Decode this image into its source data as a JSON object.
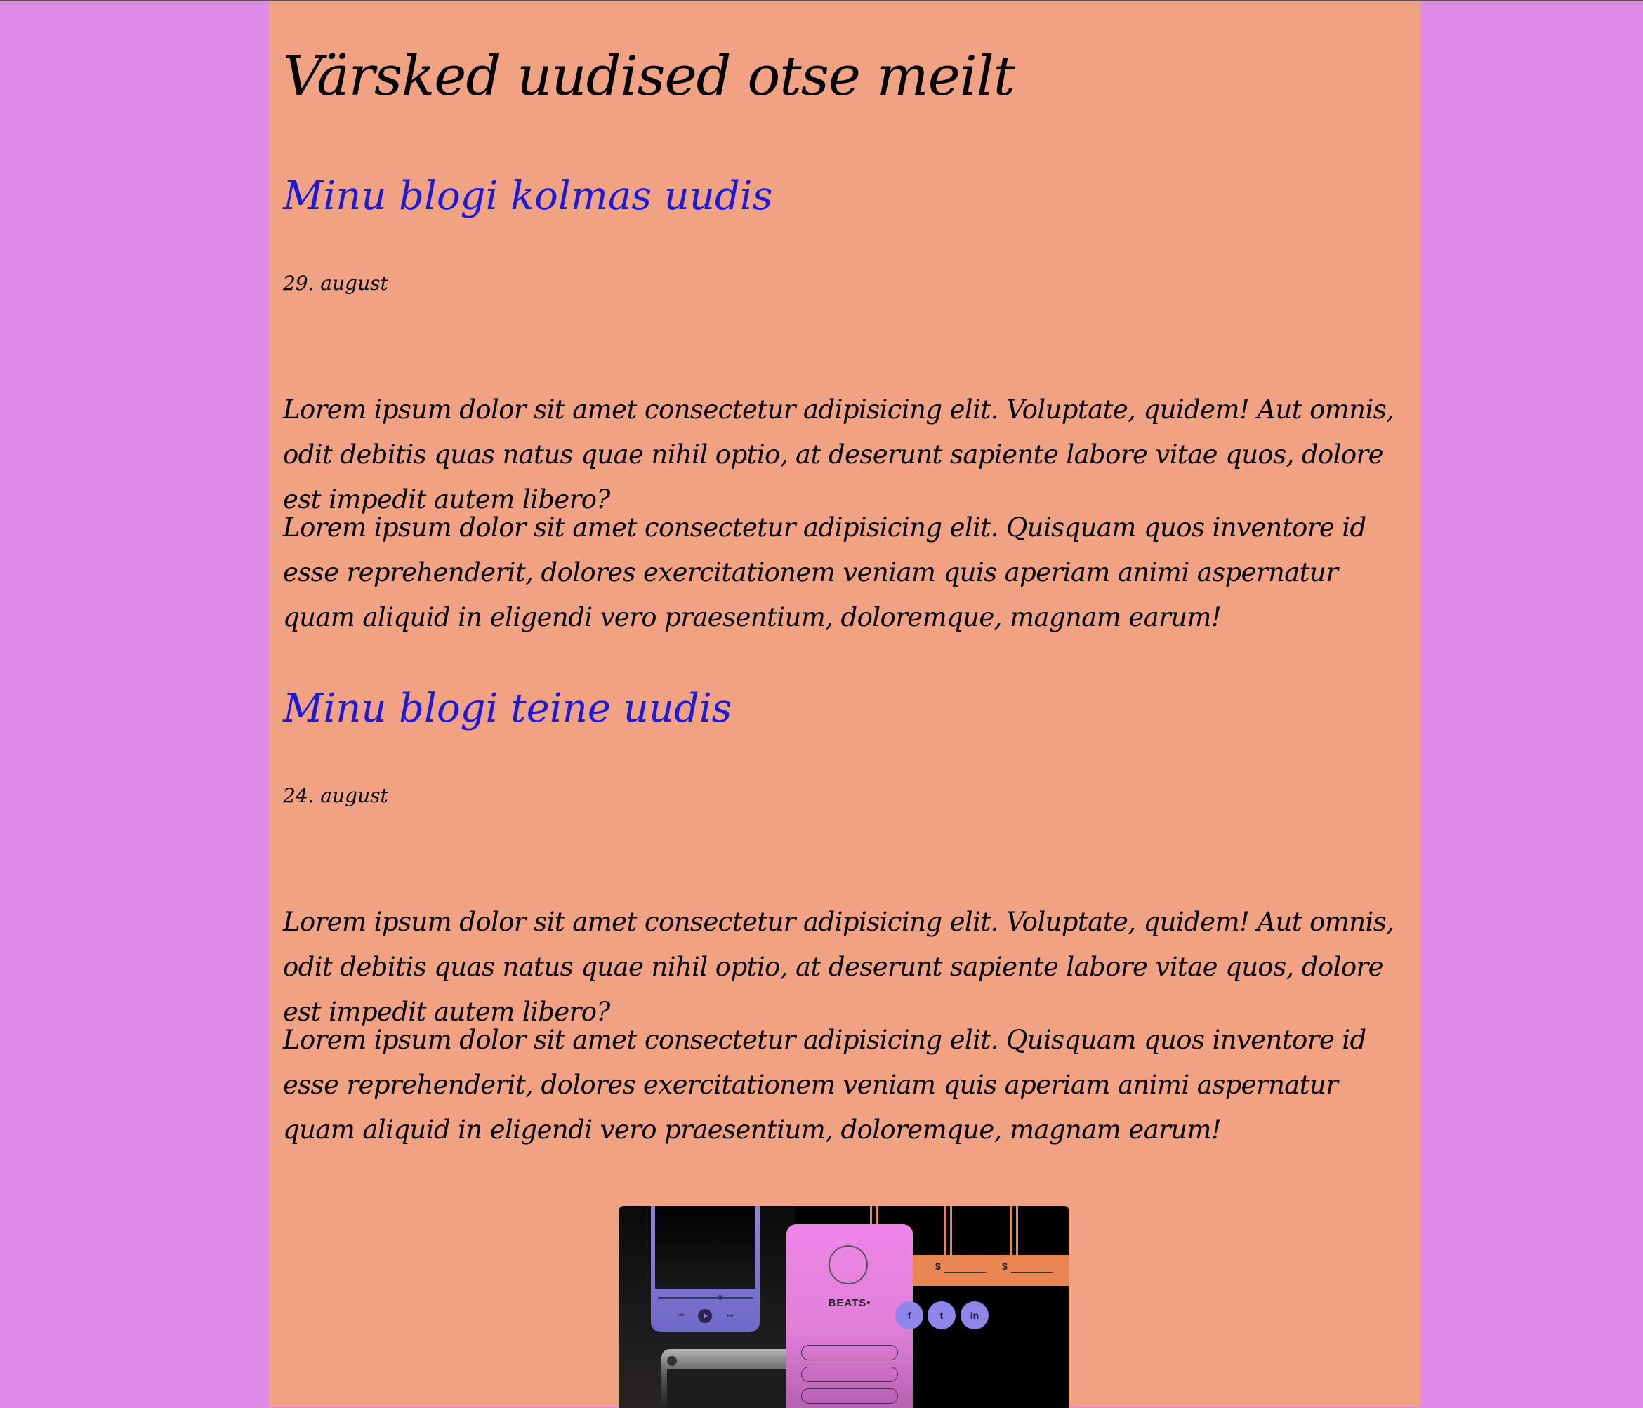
{
  "page": {
    "title": "Värsked uudised otse meilt"
  },
  "posts": [
    {
      "title": "Minu blogi kolmas uudis",
      "date": "29. august",
      "paragraphs": [
        "Lorem ipsum dolor sit amet consectetur adipisicing elit. Voluptate, quidem! Aut omnis, odit debitis quas natus quae nihil optio, at deserunt sapiente labore vitae quos, dolore est impedit autem libero?",
        "Lorem ipsum dolor sit amet consectetur adipisicing elit. Quisquam quos inventore id esse reprehenderit, dolores exercitationem veniam quis aperiam animi aspernatur quam aliquid in eligendi vero praesentium, doloremque, magnam earum!"
      ]
    },
    {
      "title": "Minu blogi teine uudis",
      "date": "24. august",
      "paragraphs": [
        "Lorem ipsum dolor sit amet consectetur adipisicing elit. Voluptate, quidem! Aut omnis, odit debitis quas natus quae nihil optio, at deserunt sapiente labore vitae quos, dolore est impedit autem libero?",
        "Lorem ipsum dolor sit amet consectetur adipisicing elit. Quisquam quos inventore id esse reprehenderit, dolores exercitationem veniam quis aperiam animi aspernatur quam aliquid in eligendi vero praesentium, doloremque, magnam earum!"
      ]
    }
  ],
  "image": {
    "brand_text": "BEATS•",
    "price_symbol": "$",
    "social_icons": [
      "facebook-icon",
      "twitter-icon",
      "linkedin-icon"
    ],
    "social_glyphs": [
      "f",
      "t",
      "in"
    ]
  },
  "colors": {
    "background": "#e08ae8",
    "page": "#f0a283",
    "link": "#1a1adf",
    "text": "#000000"
  }
}
